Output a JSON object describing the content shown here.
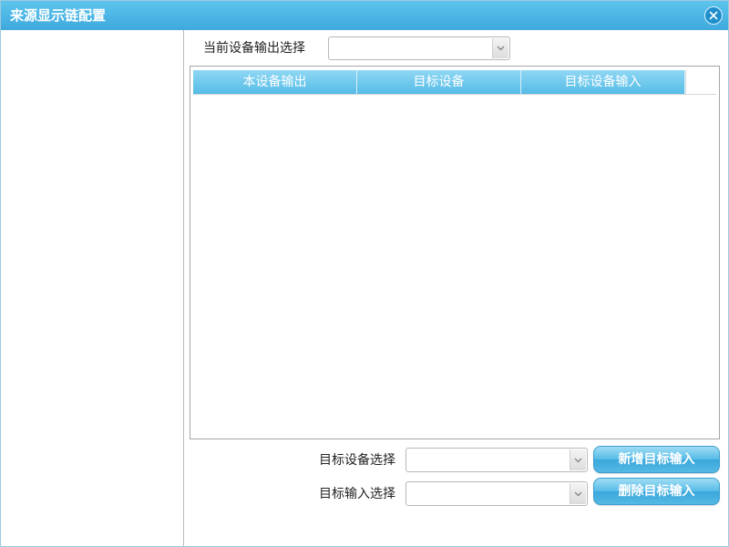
{
  "window": {
    "title": "来源显示链配置"
  },
  "current_output": {
    "label": "当前设备输出选择",
    "value": ""
  },
  "table": {
    "columns": [
      "本设备输出",
      "目标设备",
      "目标设备输入"
    ],
    "rows": []
  },
  "target_device": {
    "label": "目标设备选择",
    "value": ""
  },
  "target_input": {
    "label": "目标输入选择",
    "value": ""
  },
  "buttons": {
    "add": "新增目标输入",
    "delete": "删除目标输入"
  },
  "colors": {
    "title_bar": "#46b0e2",
    "header": "#6cc8ec",
    "button": "#4ab3e2"
  },
  "icons": {
    "close": "close-icon",
    "dropdown": "chevron-down-icon"
  }
}
